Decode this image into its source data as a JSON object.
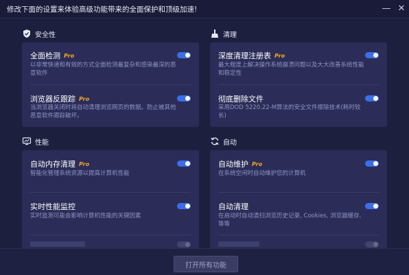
{
  "window": {
    "title": "修改下面的设置来体验高级功能带来的全面保护和顶级加速!",
    "minimize_glyph": "—",
    "close_glyph": "✕"
  },
  "sections": {
    "security": {
      "title": "安全性",
      "icon": "shield-icon",
      "items": [
        {
          "title": "全面检测",
          "pro": "Pro",
          "desc": "以非常快速和有效的方式全面检测最复杂和感染最深的恶意软件",
          "enabled": true
        },
        {
          "title": "浏览器反跟踪",
          "pro": "Pro",
          "desc": "当浏览器关闭时将自动清理浏览网页的数据。防止被其他恶意软件跟踪破坏。",
          "enabled": true
        }
      ]
    },
    "clean": {
      "title": "清理",
      "icon": "broom-icon",
      "items": [
        {
          "title": "深度清理注册表",
          "pro": "Pro",
          "desc": "最大程度上解决操作系统崩溃问题以及大大改善系统性能和稳定性",
          "enabled": true
        },
        {
          "title": "彻底删除文件",
          "pro": "",
          "desc": "采用DOD 5220.22-M算法的安全文件擦除技术(耗时较长)",
          "enabled": true
        }
      ]
    },
    "performance": {
      "title": "性能",
      "icon": "monitor-icon",
      "items": [
        {
          "title": "自动内存清理",
          "pro": "Pro",
          "desc": "智能化管理系统资源以提高计算机性能",
          "enabled": true
        },
        {
          "title": "实时性能监控",
          "pro": "",
          "desc": "实时监测可能会影响计算机性能的关键因素",
          "enabled": true
        }
      ]
    },
    "auto": {
      "title": "自动",
      "icon": "refresh-icon",
      "items": [
        {
          "title": "自动维护",
          "pro": "Pro",
          "desc": "在系统空闲时自动维护您的计算机",
          "enabled": true
        },
        {
          "title": "自动清理",
          "pro": "",
          "desc": "在启动时自动清扫浏览历史记录, Cookies, 浏览器缓存, 等等",
          "enabled": true
        }
      ]
    }
  },
  "footer": {
    "enable_all_label": "打开所有功能"
  }
}
